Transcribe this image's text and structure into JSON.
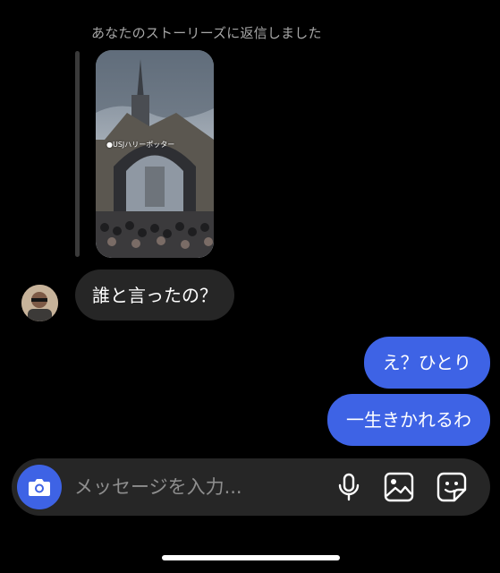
{
  "thread": {
    "reply_label": "あなたのストーリーズに返信しました",
    "story": {
      "caption": "●USJハリーポッター"
    },
    "incoming": [
      {
        "text": "誰と言ったの？"
      }
    ],
    "outgoing": [
      {
        "text": "え？ひとり"
      },
      {
        "text": "一生きかれるわ"
      }
    ]
  },
  "composer": {
    "placeholder": "メッセージを入力...",
    "camera_icon": "camera-icon",
    "mic_icon": "microphone-icon",
    "gallery_icon": "image-icon",
    "sticker_icon": "sticker-icon"
  },
  "colors": {
    "accent": "#3e63e5",
    "incoming_bubble": "#262626",
    "background": "#000000"
  }
}
